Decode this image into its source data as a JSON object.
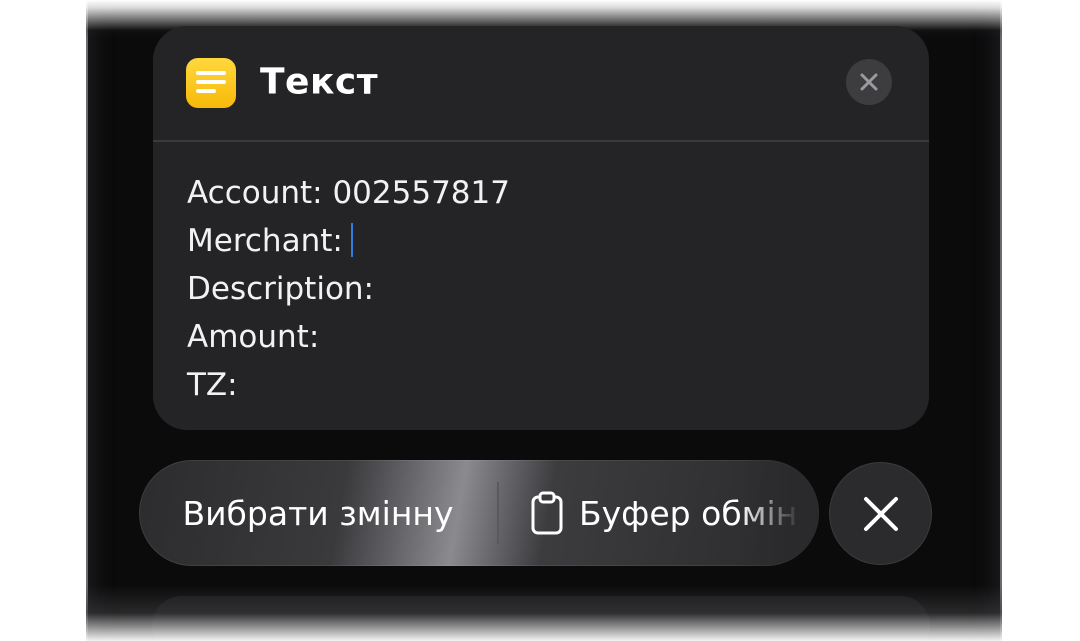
{
  "card": {
    "title": "Текст",
    "icon": "notes-icon",
    "close_icon": "close-icon"
  },
  "text_lines": [
    "Account: 002557817",
    "Merchant:",
    "Description:",
    "Amount:",
    "TZ:"
  ],
  "toolbar": {
    "select_variable_label": "Вибрати змінну",
    "clipboard_label": "Буфер обмін",
    "clipboard_icon": "clipboard-icon",
    "close_icon": "close-icon"
  },
  "colors": {
    "card_bg": "#242426",
    "accent_caret": "#2f7de1",
    "app_icon": "#fcc419"
  }
}
